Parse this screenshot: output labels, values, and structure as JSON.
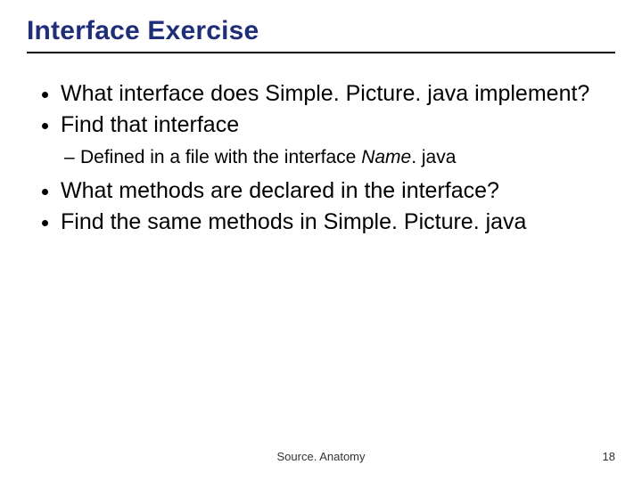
{
  "title": "Interface Exercise",
  "bullets": {
    "b1": "What interface does Simple. Picture. java implement?",
    "b2": "Find that interface",
    "b2_sub_prefix": "Defined in a file with the interface ",
    "b2_sub_name": "Name",
    "b2_sub_suffix": ". java",
    "b3": "What methods are declared in the interface?",
    "b4": "Find the same methods in Simple. Picture. java"
  },
  "footer": {
    "center": "Source. Anatomy",
    "page": "18"
  }
}
